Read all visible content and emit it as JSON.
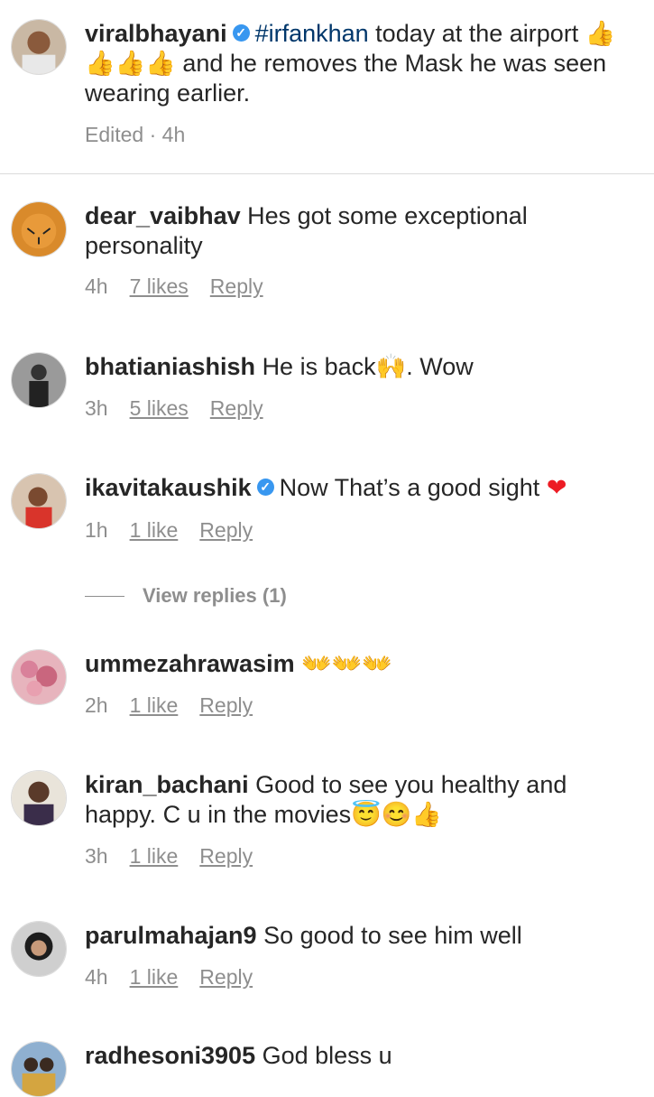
{
  "caption": {
    "username": "viralbhayani",
    "hashtag": "#irfankhan",
    "text_a": " today at the airport ",
    "emoji": "👍👍👍👍",
    "text_b": " and he removes the Mask he was seen wearing earlier.",
    "edited": "Edited · 4h"
  },
  "comments": [
    {
      "username": "dear_vaibhav",
      "text": "Hes got some exceptional personality",
      "time": "4h",
      "likes": "7 likes",
      "reply": "Reply"
    },
    {
      "username": "bhatianiashish",
      "text": "He is back🙌. Wow",
      "time": "3h",
      "likes": "5 likes",
      "reply": "Reply"
    },
    {
      "username": "ikavitakaushik",
      "text": "Now That’s a good sight ",
      "heart": "❤",
      "time": "1h",
      "likes": "1 like",
      "reply": "Reply"
    },
    {
      "username": "ummezahrawasim",
      "text": "👐👐👐",
      "time": "2h",
      "likes": "1 like",
      "reply": "Reply"
    },
    {
      "username": "kiran_bachani",
      "text": "Good to see you healthy and happy. C u in the movies😇😊👍",
      "time": "3h",
      "likes": "1 like",
      "reply": "Reply"
    },
    {
      "username": "parulmahajan9",
      "text": "So good to see him well",
      "time": "4h",
      "likes": "1 like",
      "reply": "Reply"
    },
    {
      "username": "radhesoni3905",
      "text": "God bless u"
    }
  ],
  "view_replies": "View replies (1)",
  "colors": {
    "accent": "#3897f0",
    "hashtag": "#00376b",
    "muted": "#8e8e8e",
    "heart": "#ed1c24"
  }
}
